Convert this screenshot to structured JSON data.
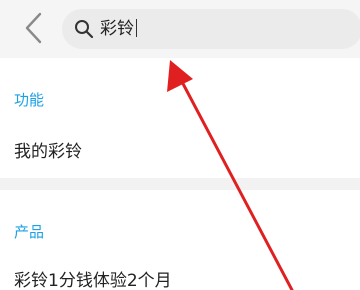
{
  "header": {
    "back_icon": "chevron-left-icon",
    "search": {
      "icon": "search-icon",
      "value": "彩铃"
    }
  },
  "sections": [
    {
      "title": "功能",
      "items": [
        "我的彩铃"
      ]
    },
    {
      "title": "产品",
      "items": [
        "彩铃1分钱体验2个月"
      ]
    }
  ],
  "colors": {
    "accent": "#1ba1e6",
    "annotation_arrow": "#e02020",
    "header_bg": "#f5f5f5",
    "search_bg": "#ebebeb",
    "divider": "#f2f2f2"
  }
}
